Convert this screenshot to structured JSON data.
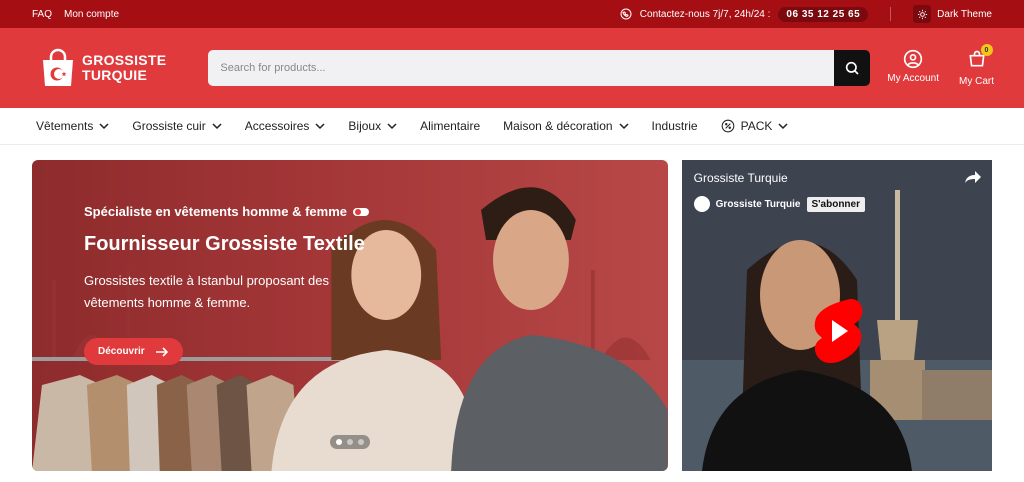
{
  "topbar": {
    "links": [
      "FAQ",
      "Mon compte"
    ],
    "contact_text": "Contactez-nous 7j/7, 24h/24 :",
    "phone": "06 35 12 25 65",
    "theme_label": "Dark Theme"
  },
  "header": {
    "logo_line1": "GROSSISTE",
    "logo_line2": "TURQUIE",
    "search_placeholder": "Search for products...",
    "account_label": "My Account",
    "cart_label": "My Cart",
    "cart_count": "0"
  },
  "nav": {
    "items": [
      {
        "label": "Vêtements",
        "dropdown": true
      },
      {
        "label": "Grossiste cuir",
        "dropdown": true
      },
      {
        "label": "Accessoires",
        "dropdown": true
      },
      {
        "label": "Bijoux",
        "dropdown": true
      },
      {
        "label": "Alimentaire",
        "dropdown": false
      },
      {
        "label": "Maison & décoration",
        "dropdown": true
      },
      {
        "label": "Industrie",
        "dropdown": false
      },
      {
        "label": "PACK",
        "dropdown": true,
        "icon": "discount-icon"
      }
    ]
  },
  "hero": {
    "tagline": "Spécialiste en vêtements homme & femme",
    "title": "Fournisseur Grossiste Textile",
    "description": "Grossistes textile à Istanbul proposant des vêtements homme & femme.",
    "cta_label": "Découvrir",
    "slides": 3,
    "active_slide": 1
  },
  "video": {
    "title": "Grossiste Turquie",
    "channel_name": "Grossiste Turquie",
    "subscribe_label": "S'abonner"
  },
  "colors": {
    "topbar": "#a50f14",
    "header": "#e03a3c",
    "accent": "#e03a3c",
    "badge": "#f5c518"
  }
}
